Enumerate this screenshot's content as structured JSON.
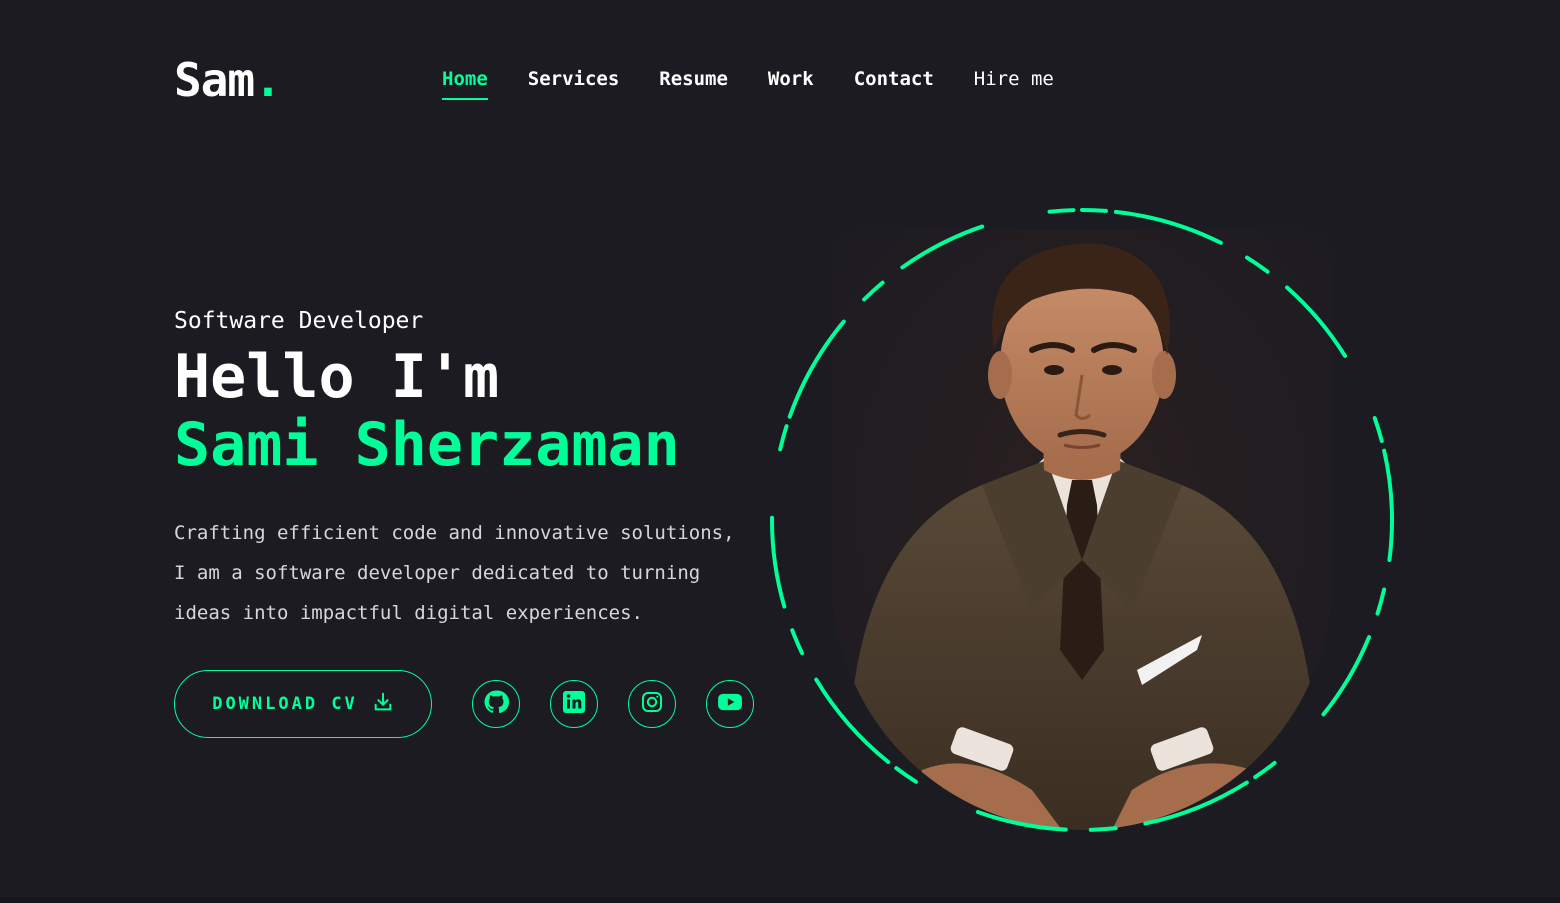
{
  "logo": {
    "text": "Sam",
    "dot": "."
  },
  "nav": {
    "items": [
      {
        "label": "Home",
        "active": true
      },
      {
        "label": "Services",
        "active": false
      },
      {
        "label": "Resume",
        "active": false
      },
      {
        "label": "Work",
        "active": false
      },
      {
        "label": "Contact",
        "active": false
      }
    ],
    "hire_label": "Hire me"
  },
  "hero": {
    "role": "Software Developer",
    "greeting": "Hello I'm",
    "name": "Sami Sherzaman",
    "description": [
      "Crafting efficient code and innovative solutions,",
      "I am a software developer dedicated to turning",
      "ideas into impactful digital experiences."
    ]
  },
  "actions": {
    "download_label": "DOWNLOAD CV",
    "download_icon": "download-icon",
    "socials": [
      {
        "name": "github",
        "icon": "github-icon"
      },
      {
        "name": "linkedin",
        "icon": "linkedin-icon"
      },
      {
        "name": "instagram",
        "icon": "instagram-icon"
      },
      {
        "name": "youtube",
        "icon": "youtube-icon"
      }
    ]
  },
  "colors": {
    "background": "#1c1b22",
    "accent": "#00ff99",
    "text": "#ffffff"
  }
}
